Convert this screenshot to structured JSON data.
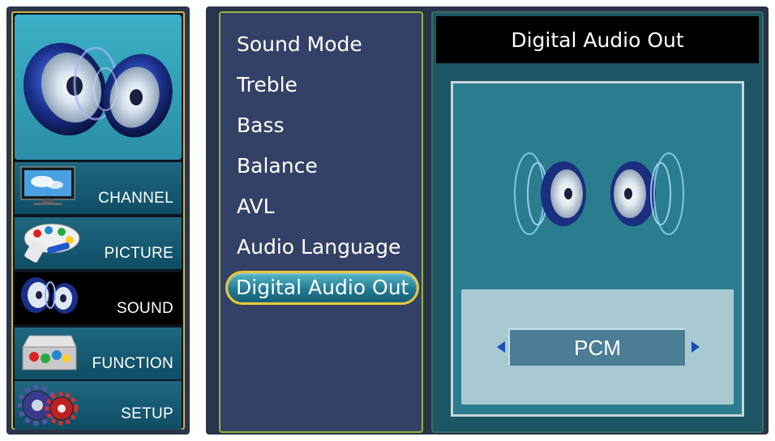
{
  "sidebar": {
    "items": [
      {
        "label": "CHANNEL",
        "icon": "tv-icon"
      },
      {
        "label": "PICTURE",
        "icon": "palette-icon"
      },
      {
        "label": "SOUND",
        "icon": "speaker-icon",
        "active": true
      },
      {
        "label": "FUNCTION",
        "icon": "toolbox-icon"
      },
      {
        "label": "SETUP",
        "icon": "gears-icon"
      }
    ]
  },
  "menu": {
    "items": [
      "Sound Mode",
      "Treble",
      "Bass",
      "Balance",
      "AVL",
      "Audio Language",
      "Digital Audio Out"
    ],
    "selected_index": 6
  },
  "detail": {
    "title": "Digital Audio Out",
    "value": "PCM",
    "left_arrow_icon": "arrow-left-icon",
    "right_arrow_icon": "arrow-right-icon"
  },
  "colors": {
    "accent_border": "#e8c83a",
    "panel_bg": "#344166",
    "detail_bg": "#2a7d8f",
    "arrow": "#1b4db0"
  }
}
